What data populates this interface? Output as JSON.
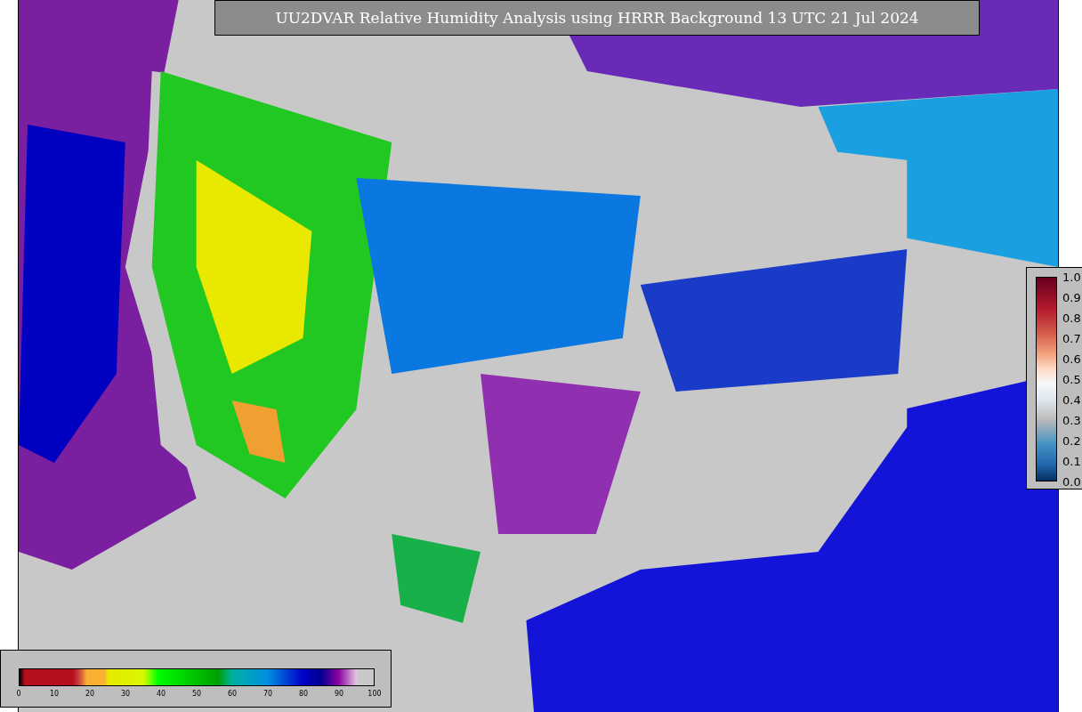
{
  "title": "UU2DVAR Relative Humidity Analysis using HRRR Background 13 UTC 21 Jul 2024",
  "humidity_colorbar": {
    "ticks": [
      "0",
      "10",
      "20",
      "30",
      "40",
      "50",
      "60",
      "70",
      "80",
      "90",
      "100"
    ]
  },
  "observation_colorbar": {
    "ticks": [
      "1.0",
      "0.9",
      "0.8",
      "0.7",
      "0.6",
      "0.5",
      "0.4",
      "0.3",
      "0.2",
      "0.1",
      "0.0"
    ]
  }
}
